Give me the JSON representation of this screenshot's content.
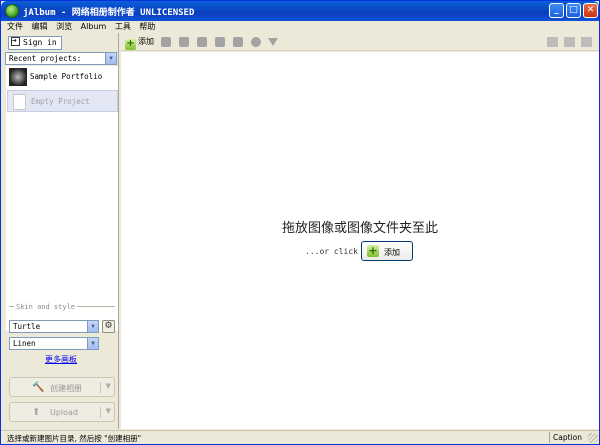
{
  "window": {
    "title": "jAlbum - 网络相册制作者 UNLICENSED",
    "controls": {
      "minimize": "_",
      "maximize": "□",
      "close": "✕"
    }
  },
  "menu": [
    "文件",
    "编辑",
    "浏览",
    "Album",
    "工具",
    "帮助"
  ],
  "sidebar": {
    "sign_in": "Sign in",
    "recent_projects_label": "Recent projects:",
    "projects": [
      {
        "name": "Sample Portfolio",
        "icon": "portfolio-thumbnail"
      },
      {
        "name": "Empty Project",
        "icon": "blank-document-icon"
      }
    ],
    "skin_section_label": "Skin and style",
    "skin": "Turtle",
    "style": "Linen",
    "more_skins_link": "更多画板",
    "make_album_button": "创建相册",
    "upload_button": "Upload"
  },
  "toolbar": {
    "add_label": "添加",
    "icons": [
      "folder-icon",
      "camera-icon",
      "move-icon",
      "arrow-left-icon",
      "arrow-right-icon",
      "circle-icon",
      "filter-icon"
    ],
    "right_icons": [
      "grid-view-icon",
      "edit-icon",
      "preview-icon"
    ]
  },
  "main": {
    "drop_hint": "拖放图像或图像文件夹至此",
    "or_click": "...or click",
    "add_button": "添加"
  },
  "status": {
    "message": "选择或新建图片目录, 然后按 \"创建相册\"",
    "caption": "Caption"
  }
}
